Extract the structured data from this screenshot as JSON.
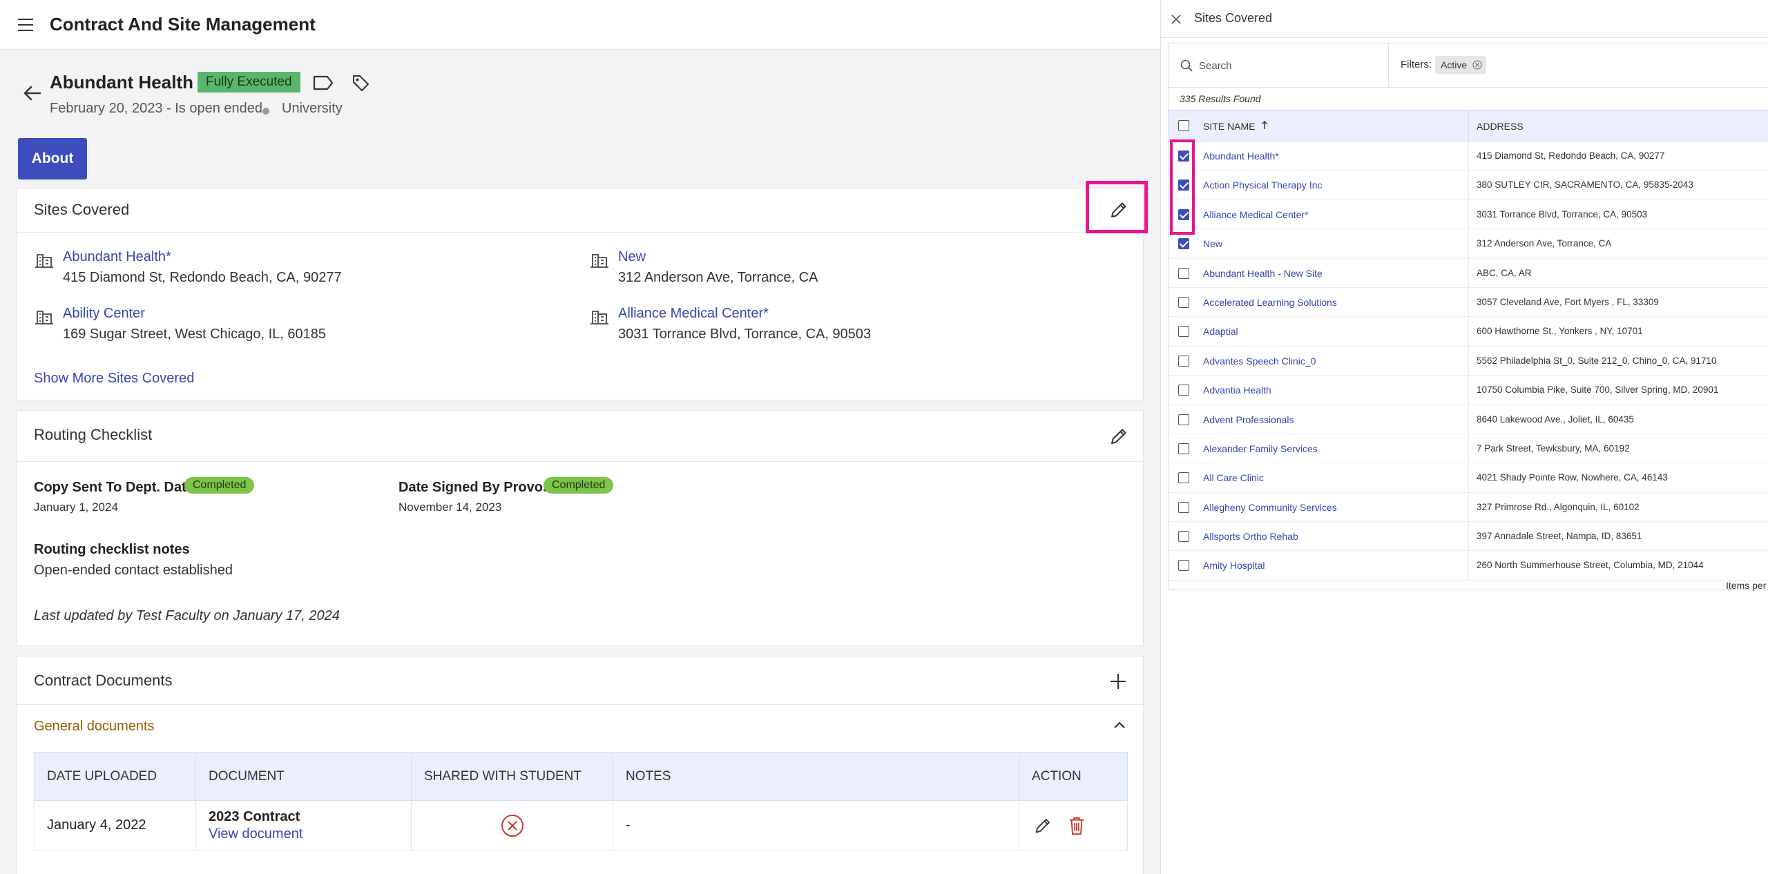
{
  "app": {
    "title": "Contract And Site Management"
  },
  "header": {
    "org_name": "Abundant Health",
    "status": "Fully Executed",
    "date_text": "February 20, 2023 - Is open ended",
    "type": "University"
  },
  "tabs": {
    "about": "About"
  },
  "sites_card": {
    "title": "Sites Covered",
    "sites": [
      {
        "name": "Abundant Health*",
        "address": "415 Diamond St, Redondo Beach, CA, 90277"
      },
      {
        "name": "New",
        "address": "312 Anderson Ave, Torrance, CA"
      },
      {
        "name": "Ability Center",
        "address": "169 Sugar Street, West Chicago, IL, 60185"
      },
      {
        "name": "Alliance Medical Center*",
        "address": "3031 Torrance Blvd, Torrance, CA, 90503"
      }
    ],
    "show_more": "Show More Sites Covered"
  },
  "routing": {
    "title": "Routing Checklist",
    "items": [
      {
        "label": "Copy Sent To Dept. Date",
        "status": "Completed",
        "value": "January 1, 2024"
      },
      {
        "label": "Date Signed By Provost",
        "status": "Completed",
        "value": "November 14, 2023"
      }
    ],
    "notes_label": "Routing checklist notes",
    "notes": "Open-ended contact established",
    "last_updated": "Last updated by Test Faculty on January 17, 2024"
  },
  "documents": {
    "title": "Contract Documents",
    "section": "General documents",
    "columns": [
      "DATE UPLOADED",
      "DOCUMENT",
      "SHARED WITH STUDENT",
      "NOTES",
      "ACTION"
    ],
    "rows": [
      {
        "date": "January 4, 2022",
        "doc_name": "2023 Contract",
        "doc_link": "View document",
        "notes": "-"
      }
    ]
  },
  "panel": {
    "title": "Sites Covered",
    "search_placeholder": "Search",
    "filters_label": "Filters:",
    "filter_chip": "Active",
    "results": "335 Results Found",
    "columns": [
      "SITE NAME",
      "ADDRESS"
    ],
    "rows": [
      {
        "name": "Abundant Health*",
        "address": "415 Diamond St, Redondo Beach, CA, 90277",
        "checked": true
      },
      {
        "name": "Action Physical Therapy Inc",
        "address": "380 SUTLEY CIR, SACRAMENTO, CA, 95835-2043",
        "checked": true
      },
      {
        "name": "Alliance Medical Center*",
        "address": "3031 Torrance Blvd, Torrance, CA, 90503",
        "checked": true
      },
      {
        "name": "New",
        "address": "312 Anderson Ave, Torrance, CA",
        "checked": true
      },
      {
        "name": "Abundant Health - New Site",
        "address": "ABC, CA, AR",
        "checked": false
      },
      {
        "name": "Accelerated Learning Solutions",
        "address": "3057 Cleveland Ave, Fort Myers , FL, 33309",
        "checked": false
      },
      {
        "name": "Adaptial",
        "address": "600 Hawthorne St., Yonkers , NY, 10701",
        "checked": false
      },
      {
        "name": "Advantes Speech Clinic_0",
        "address": "5562 Philadelphia St_0, Suite 212_0, Chino_0, CA, 91710",
        "checked": false
      },
      {
        "name": "Advantia Health",
        "address": "10750 Columbia Pike, Suite 700, Silver Spring, MD, 20901",
        "checked": false
      },
      {
        "name": "Advent Professionals",
        "address": "8640 Lakewood Ave., Joliet, IL, 60435",
        "checked": false
      },
      {
        "name": "Alexander Family Services",
        "address": "7 Park Street, Tewksbury, MA, 60192",
        "checked": false
      },
      {
        "name": "All Care Clinic",
        "address": "4021 Shady Pointe Row, Nowhere, CA, 46143",
        "checked": false
      },
      {
        "name": "Allegheny Community Services",
        "address": "327 Primrose Rd., Algonquin, IL, 60102",
        "checked": false
      },
      {
        "name": "Allsports Ortho Rehab",
        "address": "397 Annadale Street, Nampa, ID, 83651",
        "checked": false
      },
      {
        "name": "Amity Hospital",
        "address": "260 North Summerhouse Street, Columbia, MD, 21044",
        "checked": false
      }
    ],
    "items_per": "Items per"
  },
  "colors": {
    "accent": "#3d4dbd",
    "link": "#3447b0",
    "highlight": "#e8158f",
    "status_green": "#5ab66e"
  }
}
